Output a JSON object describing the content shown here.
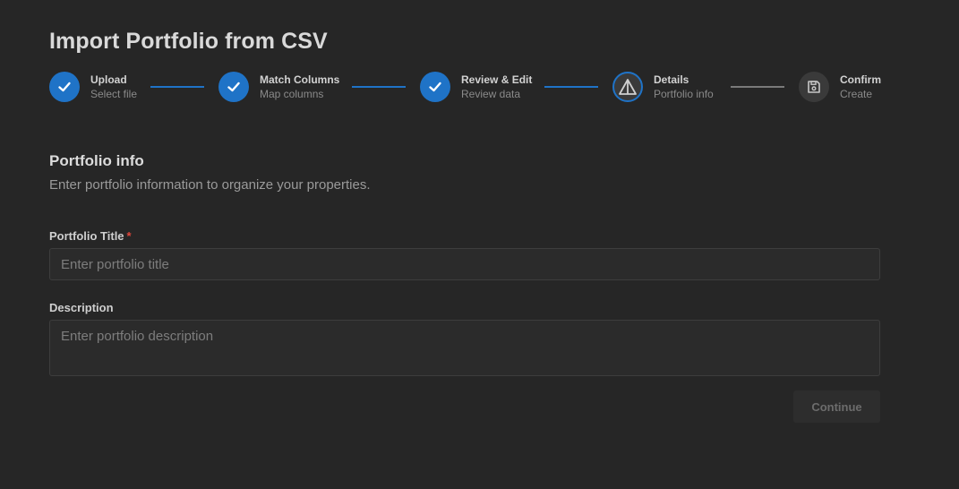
{
  "page": {
    "title": "Import Portfolio from CSV"
  },
  "stepper": {
    "steps": [
      {
        "label": "Upload",
        "sub": "Select file",
        "state": "done",
        "icon": "check-icon"
      },
      {
        "label": "Match Columns",
        "sub": "Map columns",
        "state": "done",
        "icon": "check-icon"
      },
      {
        "label": "Review & Edit",
        "sub": "Review data",
        "state": "done",
        "icon": "check-icon"
      },
      {
        "label": "Details",
        "sub": "Portfolio info",
        "state": "active",
        "icon": "warning-triangle-icon"
      },
      {
        "label": "Confirm",
        "sub": "Create",
        "state": "pending",
        "icon": "save-icon"
      }
    ]
  },
  "section": {
    "title": "Portfolio info",
    "description": "Enter portfolio information to organize your properties."
  },
  "form": {
    "title_label": "Portfolio Title",
    "required_marker": "*",
    "title_placeholder": "Enter portfolio title",
    "title_value": "",
    "description_label": "Description",
    "description_placeholder": "Enter portfolio description",
    "description_value": ""
  },
  "actions": {
    "continue_label": "Continue"
  },
  "colors": {
    "accent": "#1f73c7",
    "background": "#262626",
    "required": "#e0463b"
  }
}
